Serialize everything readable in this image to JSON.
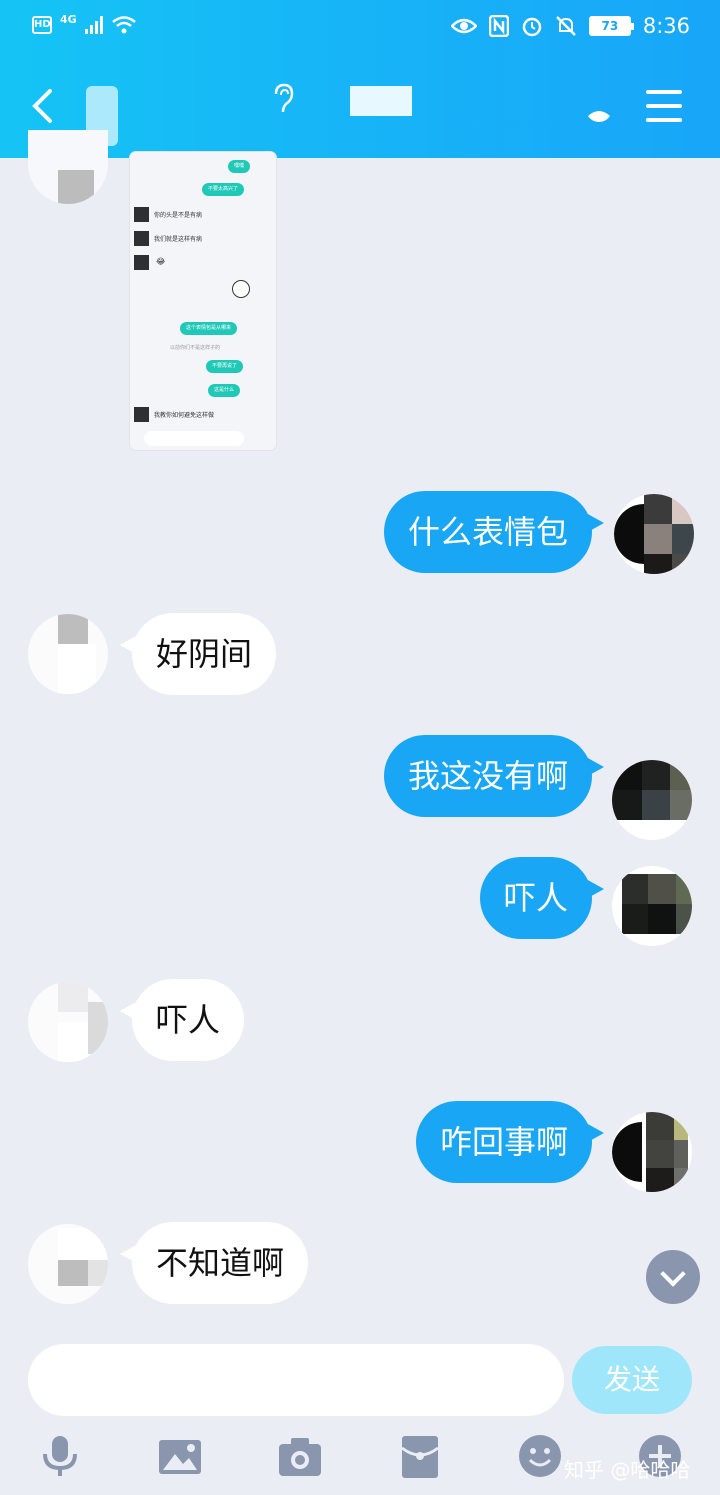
{
  "status_bar": {
    "hd": "HD",
    "network": "4G",
    "battery": "73",
    "time": "8:36"
  },
  "screenshot_preview": {
    "lines_left": [
      "你的头是不是有病",
      "我们就是这样有病",
      "😂",
      "我教你如何避免这样做"
    ],
    "lines_right": [
      "嘿嘿",
      "不要太高兴了",
      "这个表情包是从哪来",
      "不要再说了",
      "这是什么"
    ],
    "note": "以前你们不是这样子的"
  },
  "messages": [
    {
      "from": "me",
      "text": "什么表情包"
    },
    {
      "from": "other",
      "text": "好阴间"
    },
    {
      "from": "me",
      "text": "我这没有啊"
    },
    {
      "from": "me",
      "text": "吓人"
    },
    {
      "from": "other",
      "text": "吓人"
    },
    {
      "from": "me",
      "text": "咋回事啊"
    },
    {
      "from": "other",
      "text": "不知道啊"
    }
  ],
  "composer": {
    "input_value": "",
    "send_label": "发送"
  },
  "watermark": "知乎 @哈哈哈",
  "colors": {
    "header_start": "#15c4f5",
    "header_end": "#18a6f8",
    "my_bubble": "#19a6f4",
    "background": "#eaedf4",
    "toolbar_icon": "#8a96ad"
  }
}
